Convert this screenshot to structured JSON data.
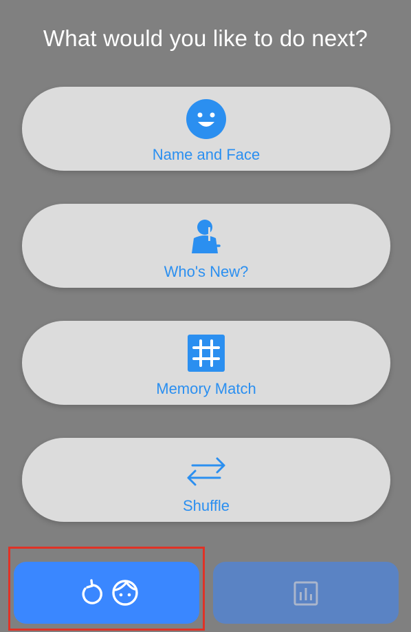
{
  "header": {
    "title": "What would you like to do next?"
  },
  "options": [
    {
      "label": "Name and Face",
      "icon": "smiley-face-icon"
    },
    {
      "label": "Who's New?",
      "icon": "person-add-icon"
    },
    {
      "label": "Memory Match",
      "icon": "grid-icon"
    },
    {
      "label": "Shuffle",
      "icon": "swap-arrows-icon"
    }
  ],
  "bottom_bar": {
    "restart_button": {
      "icons": [
        "refresh-icon",
        "face-outline-icon"
      ]
    },
    "stats_button": {
      "icon": "bar-chart-icon"
    }
  },
  "colors": {
    "background": "#808080",
    "card": "#dcdcdc",
    "accent": "#2b8ff0",
    "restart_button": "#3a87ff",
    "stats_button": "#5a83c4",
    "highlight": "#e03226"
  }
}
